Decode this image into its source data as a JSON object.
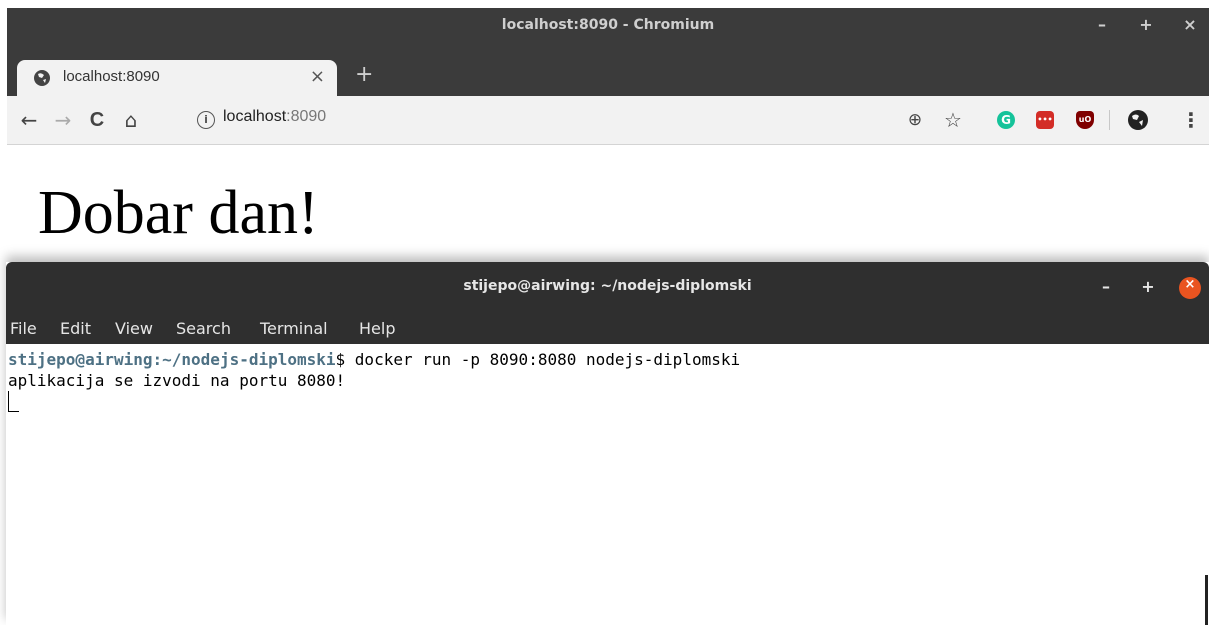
{
  "browser": {
    "window_title": "localhost:8090 - Chromium",
    "window_controls": {
      "minimize": "–",
      "maximize": "+",
      "close": "×"
    },
    "tab": {
      "title": "localhost:8090",
      "close_glyph": "×"
    },
    "new_tab_glyph": "+",
    "nav": {
      "back": "←",
      "forward": "→",
      "reload": "C",
      "home": "⌂"
    },
    "address": {
      "info_glyph": "i",
      "host": "localhost",
      "port": ":8090"
    },
    "actions": {
      "zoom": "⊕",
      "bookmark": "☆",
      "menu": "⋮"
    },
    "extensions": [
      {
        "name": "grammarly-extension-icon",
        "color": "#15c39a",
        "glyph": "G"
      },
      {
        "name": "lastpass-extension-icon",
        "color": "#d32d27",
        "glyph": "•••"
      },
      {
        "name": "ublock-extension-icon",
        "color": "#800000",
        "glyph": "uO"
      }
    ],
    "page": {
      "heading": "Dobar dan!"
    }
  },
  "terminal": {
    "window_title": "stijepo@airwing: ~/nodejs-diplomski",
    "window_controls": {
      "minimize": "–",
      "maximize": "+",
      "close": "×"
    },
    "menu": [
      "File",
      "Edit",
      "View",
      "Search",
      "Terminal",
      "Help"
    ],
    "prompt_user": "stijepo@airwing",
    "prompt_sep": ":",
    "prompt_path": "~/nodejs-diplomski",
    "prompt_symbol": "$ ",
    "command": "docker run -p 8090:8080 nodejs-diplomski",
    "output": "aplikacija se izvodi na portu 8080!",
    "accent_color": "#e95420"
  }
}
